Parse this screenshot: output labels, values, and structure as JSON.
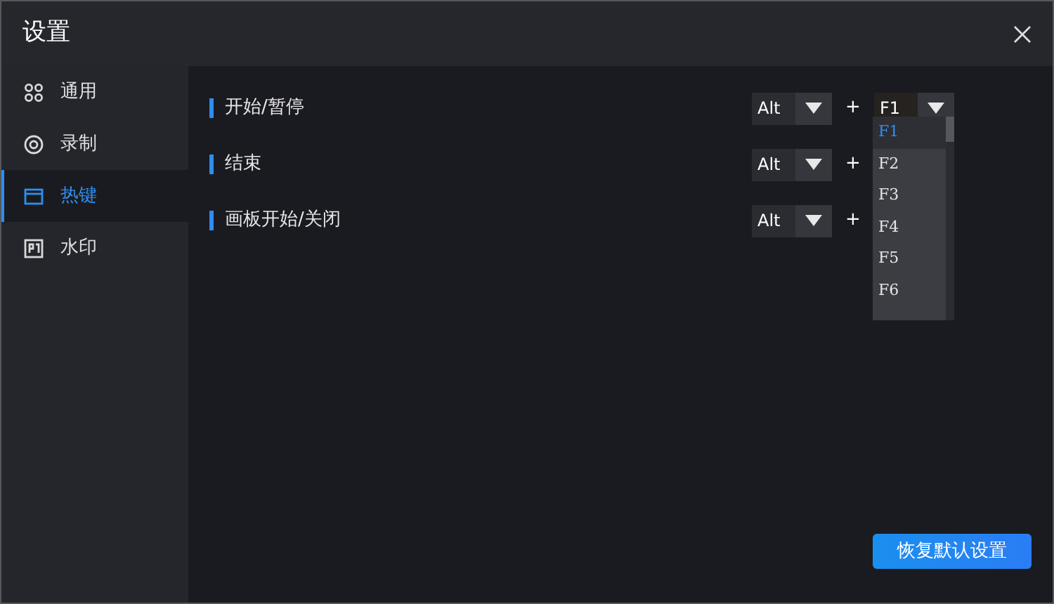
{
  "window": {
    "title": "设置"
  },
  "sidebar": {
    "items": [
      {
        "label": "通用",
        "selected": false
      },
      {
        "label": "录制",
        "selected": false
      },
      {
        "label": "热键",
        "selected": true
      },
      {
        "label": "水印",
        "selected": false
      }
    ]
  },
  "hotkeys": [
    {
      "label": "开始/暂停",
      "modifier": "Alt",
      "plus": "+",
      "key": "F1"
    },
    {
      "label": "结束",
      "modifier": "Alt",
      "plus": "+"
    },
    {
      "label": "画板开始/关闭",
      "modifier": "Alt",
      "plus": "+"
    }
  ],
  "key_dropdown": {
    "expanded": true,
    "options": [
      {
        "label": "F1",
        "selected": true
      },
      {
        "label": "F2",
        "selected": false
      },
      {
        "label": "F3",
        "selected": false
      },
      {
        "label": "F4",
        "selected": false
      },
      {
        "label": "F5",
        "selected": false
      },
      {
        "label": "F6",
        "selected": false
      }
    ]
  },
  "reset_button": "恢复默认设置"
}
